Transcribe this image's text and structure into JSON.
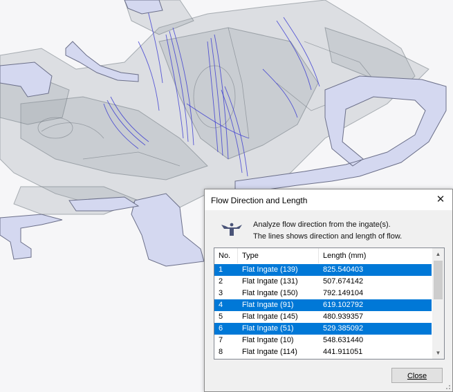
{
  "dialog": {
    "title": "Flow Direction and Length",
    "description_line1": "Analyze flow direction from the ingate(s).",
    "description_line2": "The lines shows direction and length of flow.",
    "close_button": "Close",
    "columns": [
      "No.",
      "Type",
      "Length (mm)"
    ],
    "rows": [
      {
        "no": "1",
        "type": "Flat Ingate (139)",
        "length": "825.540403",
        "selected": true
      },
      {
        "no": "2",
        "type": "Flat Ingate (131)",
        "length": "507.674142",
        "selected": false
      },
      {
        "no": "3",
        "type": "Flat Ingate (150)",
        "length": "792.149104",
        "selected": false
      },
      {
        "no": "4",
        "type": "Flat Ingate (91)",
        "length": "619.102792",
        "selected": true
      },
      {
        "no": "5",
        "type": "Flat Ingate (145)",
        "length": "480.939357",
        "selected": false
      },
      {
        "no": "6",
        "type": "Flat Ingate (51)",
        "length": "529.385092",
        "selected": true
      },
      {
        "no": "7",
        "type": "Flat Ingate (10)",
        "length": "548.631440",
        "selected": false
      },
      {
        "no": "8",
        "type": "Flat Ingate (114)",
        "length": "441.911051",
        "selected": false
      }
    ]
  },
  "icons": {
    "close": "close-icon",
    "flow": "flow-direction-icon",
    "scroll_up": "scroll-up-icon",
    "scroll_down": "scroll-down-icon",
    "resize": "resize-grip-icon"
  },
  "colors": {
    "selection": "#0078d7",
    "model_surface": "#d4d8f0",
    "flow_lines": "#2a2ad0"
  }
}
